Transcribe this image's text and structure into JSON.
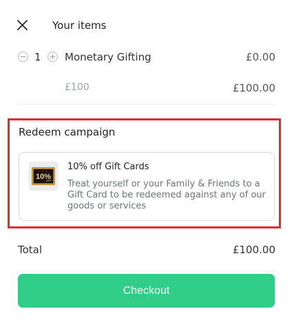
{
  "header": {
    "title": "Your items",
    "close_icon": "close-icon"
  },
  "cart": {
    "items": [
      {
        "quantity": "1",
        "name": "Monetary Gifting",
        "price": "£0.00",
        "variant": {
          "name": "£100",
          "price": "£100.00"
        }
      }
    ]
  },
  "redeem": {
    "title": "Redeem campaign",
    "campaign": {
      "title": "10% off Gift Cards",
      "description": "Treat yourself or your Family & Friends to a Gift Card to be redeemed against any of our goods or services",
      "thumbnail_text": "10%",
      "thumbnail_subtext": "OFF"
    },
    "highlight_color": "#e32a33"
  },
  "summary": {
    "total_label": "Total",
    "total_value": "£100.00"
  },
  "checkout": {
    "label": "Checkout",
    "color": "#2fcd88"
  }
}
